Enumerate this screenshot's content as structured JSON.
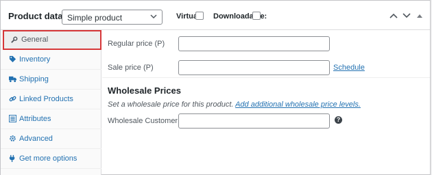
{
  "header": {
    "title": "Product data —",
    "product_type": "Simple product",
    "virtual_label": "Virtual:",
    "downloadable_label": "Downloadable:"
  },
  "sidebar": {
    "items": [
      {
        "label": "General",
        "icon": "wrench-icon",
        "active": true
      },
      {
        "label": "Inventory",
        "icon": "tag-icon"
      },
      {
        "label": "Shipping",
        "icon": "truck-icon"
      },
      {
        "label": "Linked Products",
        "icon": "link-icon"
      },
      {
        "label": "Attributes",
        "icon": "list-icon"
      },
      {
        "label": "Advanced",
        "icon": "gear-icon"
      },
      {
        "label": "Get more options",
        "icon": "plugin-icon"
      }
    ]
  },
  "general": {
    "regular_price_label": "Regular price (P)",
    "sale_price_label": "Sale price (P)",
    "schedule_link": "Schedule"
  },
  "wholesale": {
    "title": "Wholesale Prices",
    "description": "Set a wholesale price for this product.",
    "add_link": "Add additional wholesale price levels.",
    "customer_label": "Wholesale Customer (P)",
    "help_glyph": "?"
  },
  "colors": {
    "link": "#2271b1",
    "active_outline": "#d63638",
    "border": "#c3c4c7"
  }
}
